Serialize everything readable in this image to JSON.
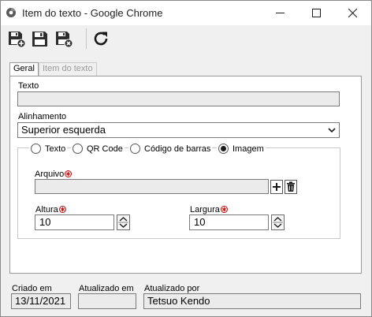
{
  "window": {
    "title": "Item do texto - Google Chrome"
  },
  "tabs": {
    "geral": "Geral",
    "item": "Item do texto"
  },
  "form": {
    "texto_label": "Texto",
    "texto_value": "",
    "alinhamento_label": "Alinhamento",
    "alinhamento_value": "Superior esquerda",
    "radios": {
      "texto": "Texto",
      "qrcode": "QR Code",
      "barras": "Código de barras",
      "imagem": "Imagem",
      "selected": "Imagem"
    },
    "arquivo_label": "Arquivo",
    "arquivo_value": "",
    "altura_label": "Altura",
    "altura_value": "10",
    "largura_label": "Largura",
    "largura_value": "10"
  },
  "footer": {
    "criado_label": "Criado em",
    "criado_value": "13/11/2021",
    "atualizado_label": "Atualizado em",
    "atualizado_value": "",
    "por_label": "Atualizado por",
    "por_value": "Tetsuo Kendo"
  },
  "colors": {
    "required": "#cc0000",
    "accent_refresh": "#1a1a1a"
  }
}
